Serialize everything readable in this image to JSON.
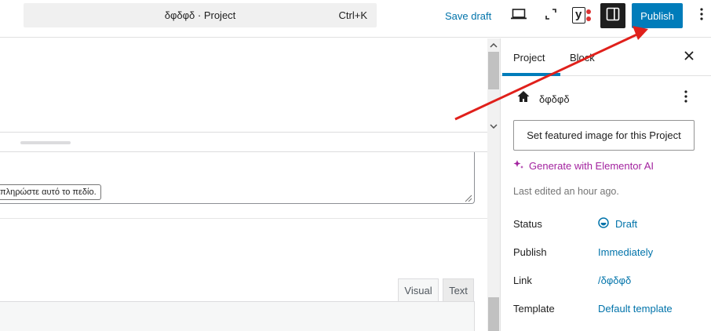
{
  "topbar": {
    "command_title": "δφδφδ · Project",
    "command_shortcut": "Ctrl+K",
    "save_draft": "Save draft",
    "yoast_label": "y",
    "publish": "Publish"
  },
  "editor": {
    "validation_tooltip": "πληρώστε αυτό το πεδίο.",
    "tabs": {
      "visual": "Visual",
      "text": "Text"
    }
  },
  "sidebar": {
    "tabs": {
      "project": "Project",
      "block": "Block"
    },
    "post_title": "δφδφδ",
    "featured_image_button": "Set featured image for this Project",
    "ai_button": "Generate with Elementor AI",
    "last_edited": "Last edited an hour ago.",
    "props": {
      "status": {
        "label": "Status",
        "value": "Draft"
      },
      "publish": {
        "label": "Publish",
        "value": "Immediately"
      },
      "link": {
        "label": "Link",
        "value": "/δφδφδ"
      },
      "template": {
        "label": "Template",
        "value": "Default template"
      }
    }
  },
  "colors": {
    "accent": "#007cba",
    "link": "#0073aa",
    "annotation_arrow": "#e0201b",
    "ai": "#a3239f"
  }
}
